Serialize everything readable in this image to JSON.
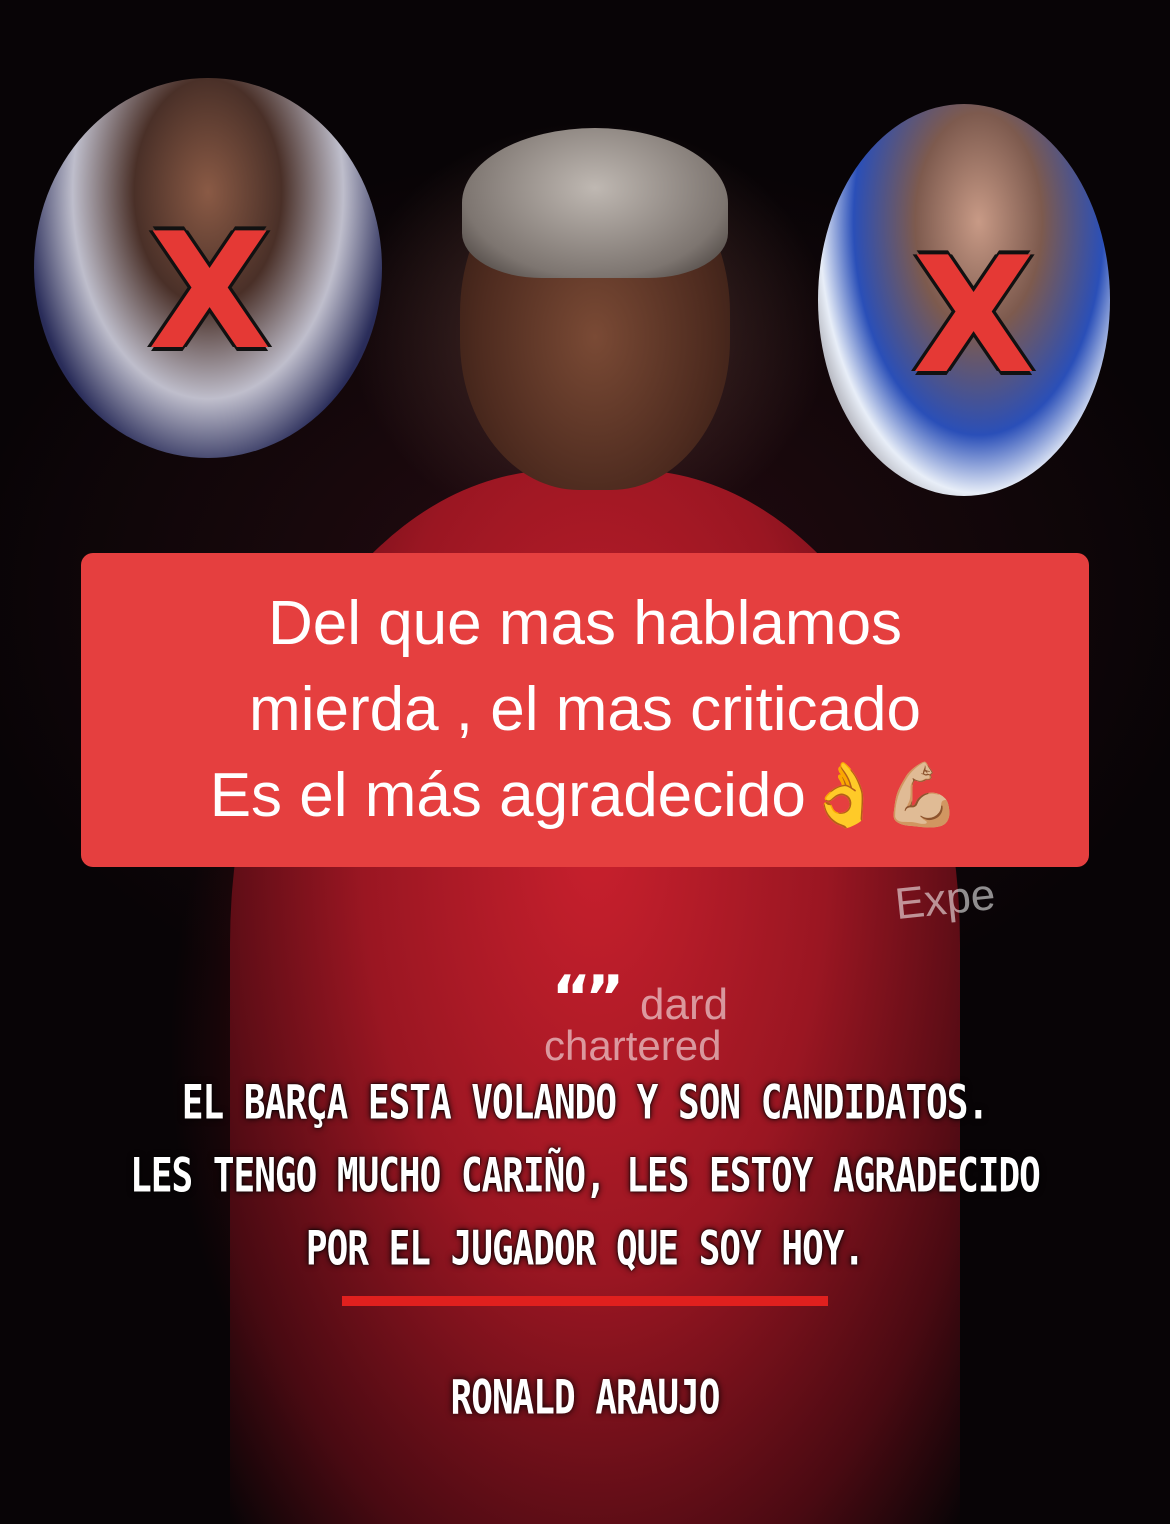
{
  "caption": {
    "lines": [
      "Del que mas hablamos",
      "mierda , el mas criticado",
      "Es el más agradecido👌💪🏼"
    ],
    "background_color": "#e53f3f"
  },
  "marks": {
    "x_symbol": "X",
    "x_color": "#e53935"
  },
  "sponsor": {
    "expedia": "Expe",
    "standard": "dard",
    "chartered": "chartered"
  },
  "quote": {
    "mark": "“”",
    "lines": [
      "EL BARÇA ESTA VOLANDO Y SON CANDIDATOS.",
      "LES TENGO MUCHO CARIÑO, LES ESTOY AGRADECIDO",
      "POR EL JUGADOR QUE SOY HOY."
    ],
    "author": "RONALD ARAUJO",
    "divider_color": "#e0201e"
  }
}
